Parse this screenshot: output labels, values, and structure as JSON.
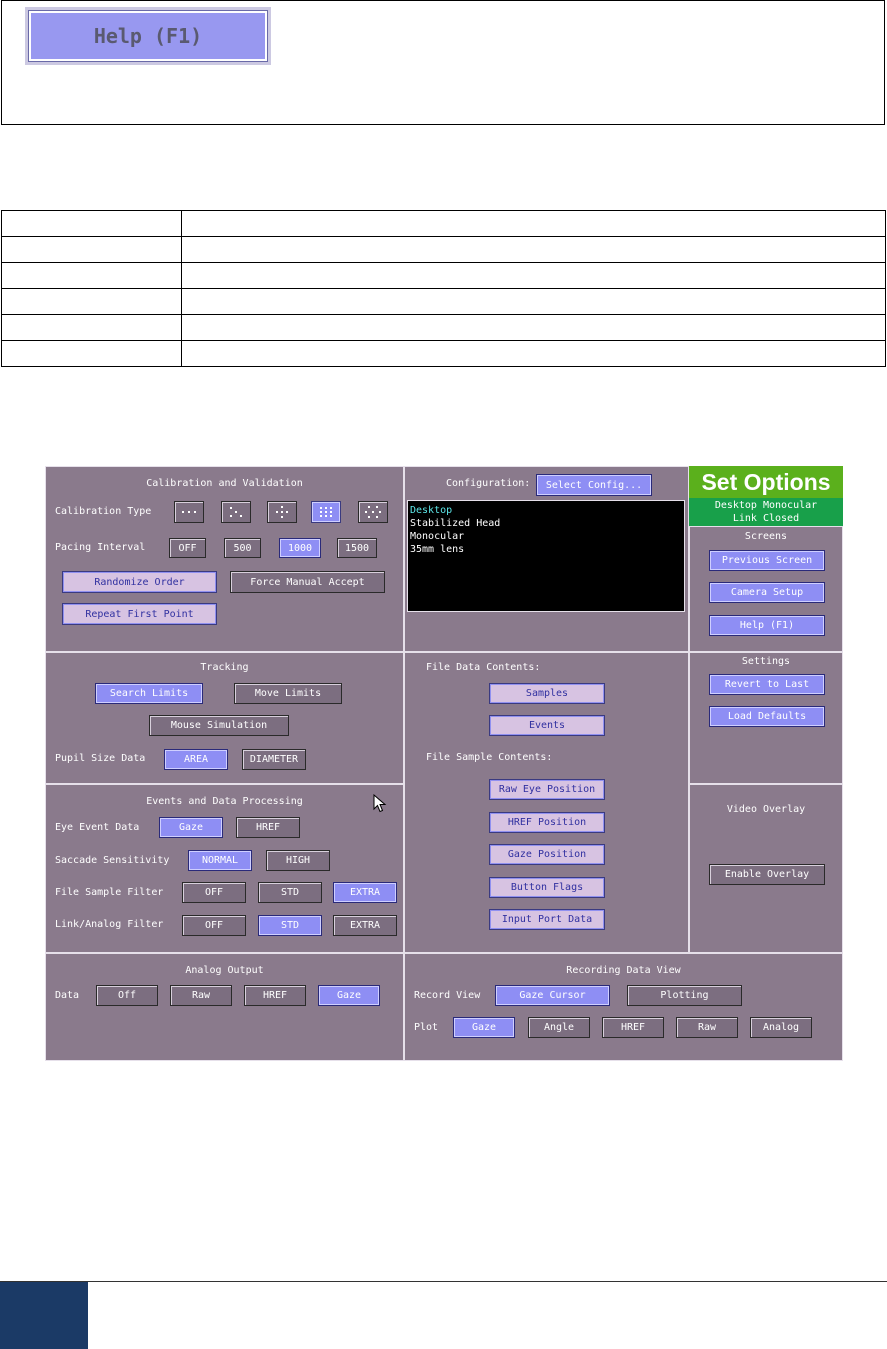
{
  "help_button_label": "Help (F1)",
  "ui": {
    "calibration": {
      "title": "Calibration and Validation",
      "type_label": "Calibration Type",
      "pacing_label": "Pacing Interval",
      "pacing_options": [
        "OFF",
        "500",
        "1000",
        "1500"
      ],
      "randomize": "Randomize Order",
      "force_manual": "Force Manual Accept",
      "repeat_first": "Repeat First Point"
    },
    "configuration": {
      "label": "Configuration:",
      "select_button": "Select  Config...",
      "items": [
        "Desktop",
        "Stabilized Head",
        "Monocular",
        "35mm lens"
      ]
    },
    "header": {
      "title": "Set Options",
      "status_line1": "Desktop Monocular",
      "status_line2": "Link Closed"
    },
    "screens": {
      "title": "Screens",
      "previous": "Previous Screen",
      "camera": "Camera Setup",
      "help": "Help (F1)"
    },
    "tracking": {
      "title": "Tracking",
      "search_limits": "Search Limits",
      "move_limits": "Move Limits",
      "mouse_sim": "Mouse Simulation",
      "pupil_label": "Pupil Size Data",
      "area": "AREA",
      "diameter": "DIAMETER"
    },
    "file_data": {
      "contents_label": "File Data Contents:",
      "samples": "Samples",
      "events": "Events",
      "sample_contents_label": "File Sample Contents:",
      "raw_eye": "Raw Eye Position",
      "href_pos": "HREF Position",
      "gaze_pos": "Gaze Position",
      "button_flags": "Button Flags",
      "input_port": "Input Port Data"
    },
    "settings": {
      "title": "Settings",
      "revert": "Revert to Last",
      "defaults": "Load Defaults"
    },
    "events": {
      "title": "Events and Data Processing",
      "eye_event_label": "Eye Event Data",
      "gaze": "Gaze",
      "href": "HREF",
      "saccade_label": "Saccade Sensitivity",
      "normal": "NORMAL",
      "high": "HIGH",
      "file_filter_label": "File Sample Filter",
      "link_filter_label": "Link/Analog Filter",
      "filter_options": [
        "OFF",
        "STD",
        "EXTRA"
      ]
    },
    "video": {
      "title": "Video Overlay",
      "enable": "Enable Overlay"
    },
    "analog": {
      "title": "Analog Output",
      "data_label": "Data",
      "options": [
        "Off",
        "Raw",
        "HREF",
        "Gaze"
      ]
    },
    "recording": {
      "title": "Recording Data View",
      "record_label": "Record View",
      "gaze_cursor": "Gaze Cursor",
      "plotting": "Plotting",
      "plot_label": "Plot",
      "plot_options": [
        "Gaze",
        "Angle",
        "HREF",
        "Raw",
        "Analog"
      ]
    }
  },
  "colors": {
    "panel_bg": "#8a7a8c",
    "button_on": "#d7c3e2",
    "button_blue": "#8e8ef4",
    "title_green": "#5bb01c",
    "status_green": "#18a04a",
    "selected_config": "#5ee8ea",
    "footer_block": "#1b3a66"
  }
}
